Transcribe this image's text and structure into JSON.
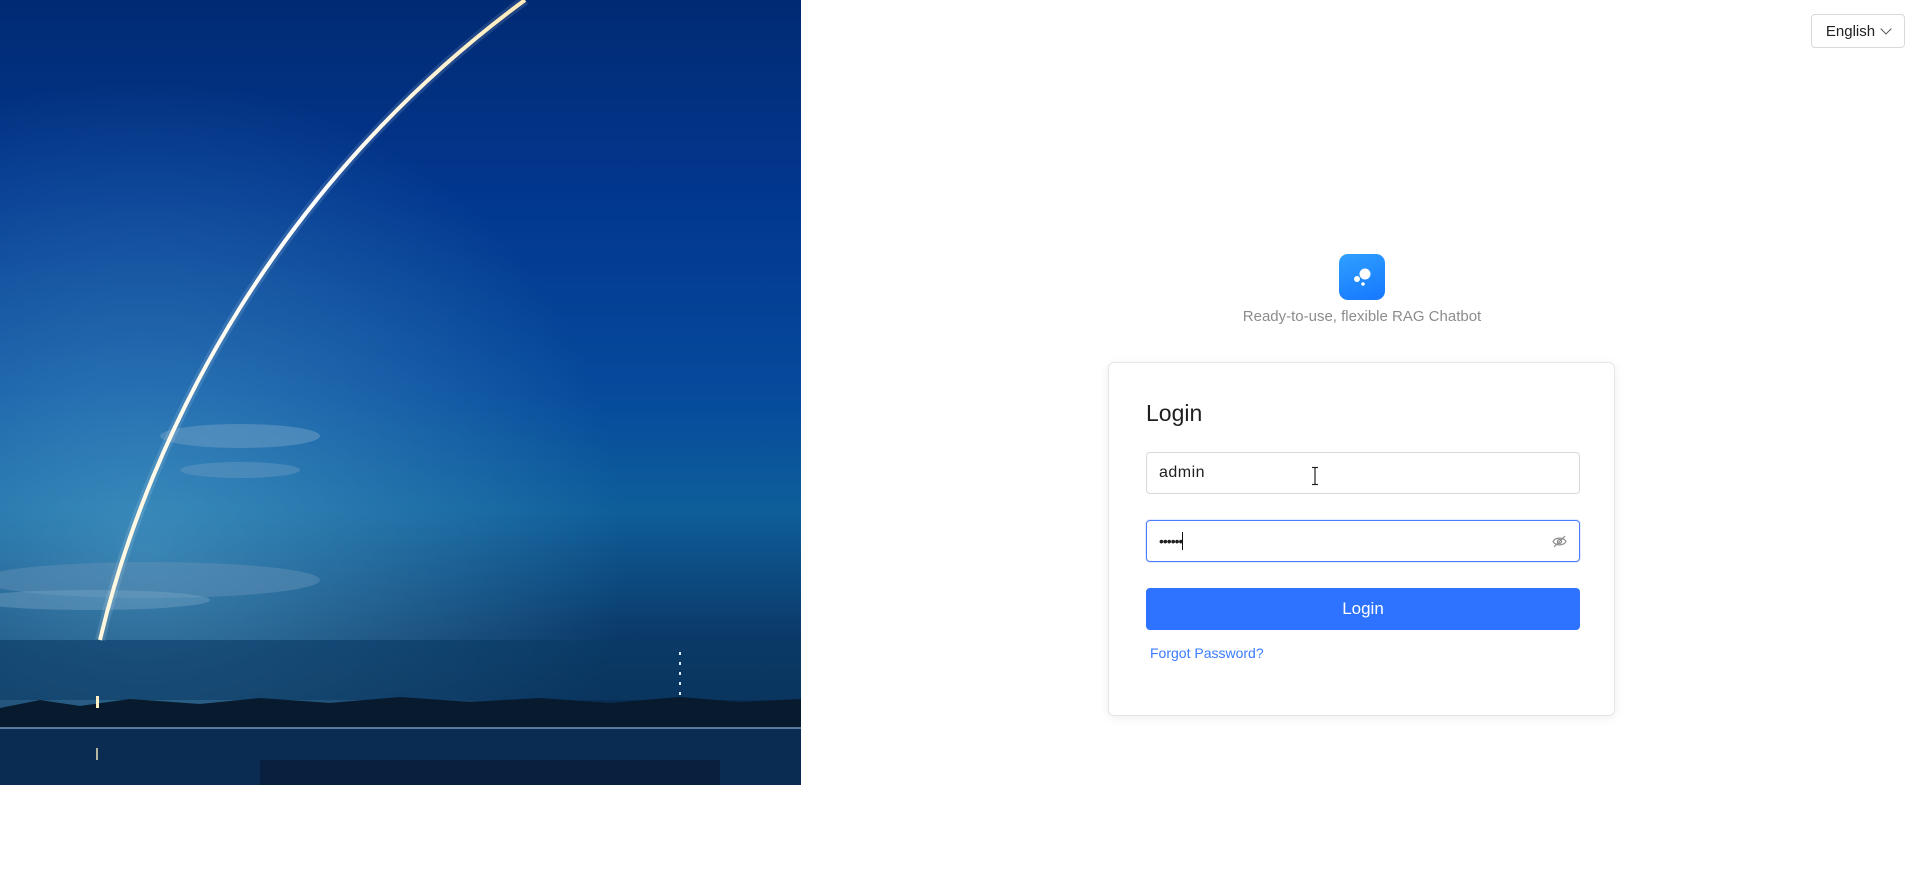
{
  "language_selector": {
    "value": "English"
  },
  "brand": {
    "tagline": "Ready-to-use, flexible RAG Chatbot",
    "logo_icon": "chat-bubbles-icon",
    "accent_color": "#1677ff"
  },
  "login": {
    "title": "Login",
    "username_value": "admin",
    "password_value": "••••••",
    "login_button_label": "Login",
    "forgot_password_label": "Forgot Password?",
    "button_color": "#2d73ff"
  },
  "hero": {
    "image": "rocket-launch-night-sky"
  }
}
